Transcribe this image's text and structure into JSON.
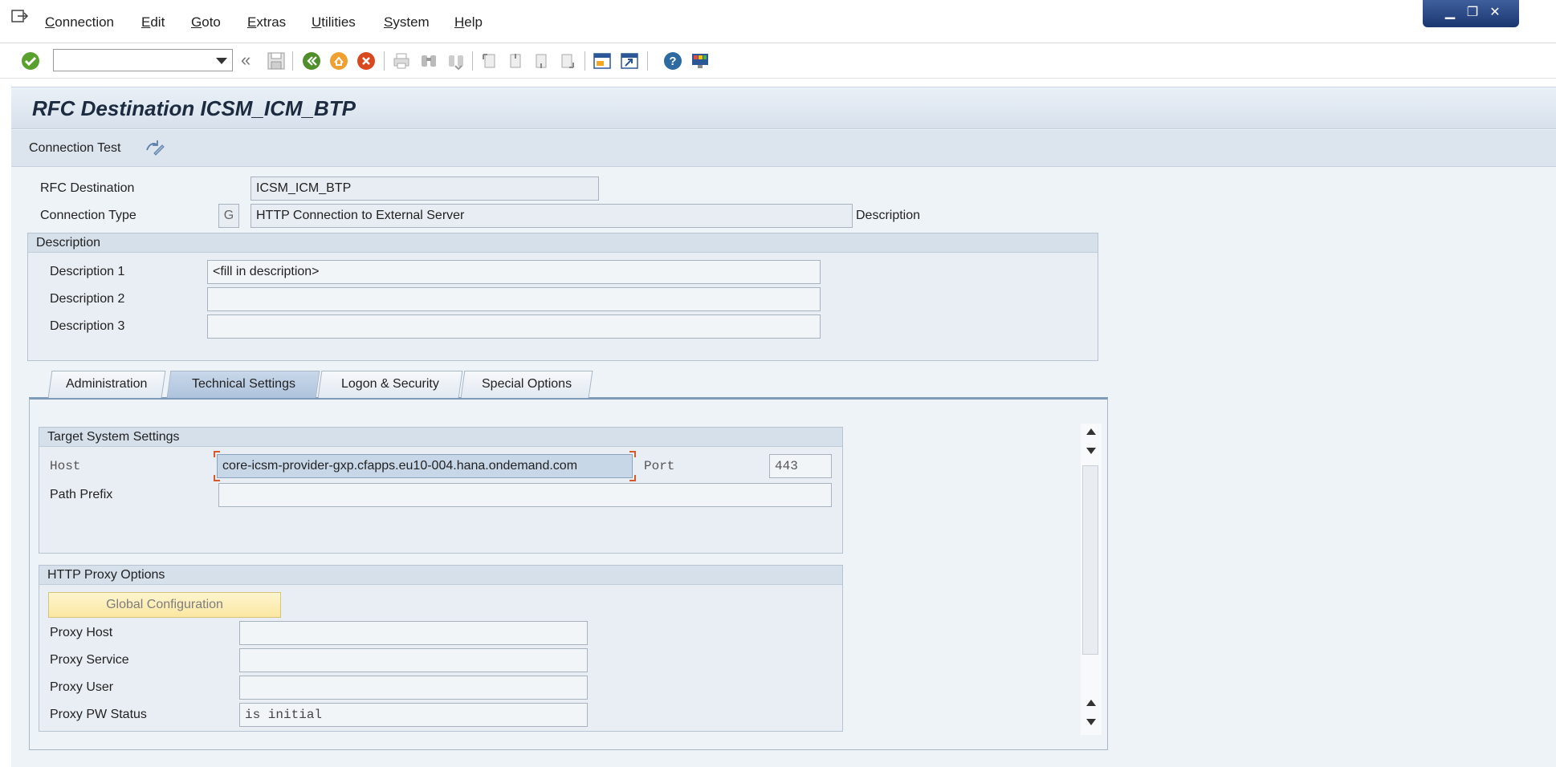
{
  "menubar": {
    "items": [
      "Connection",
      "Edit",
      "Goto",
      "Extras",
      "Utilities",
      "System",
      "Help"
    ]
  },
  "window_controls": {
    "minimize": "▁",
    "restore": "❐",
    "close": "✕"
  },
  "toolbar": {
    "command_field_value": "",
    "icons": [
      "enter-icon",
      "back-icon",
      "exit-icon",
      "cancel-icon",
      "save-icon",
      "print-icon",
      "find-icon",
      "find-next-icon",
      "first-page-icon",
      "previous-page-icon",
      "next-page-icon",
      "last-page-icon",
      "create-session-icon",
      "shortcut-icon",
      "help-icon",
      "customize-layout-icon"
    ]
  },
  "screen": {
    "title": "RFC Destination ICSM_ICM_BTP",
    "connection_test_label": "Connection Test"
  },
  "header_fields": {
    "rfc_destination_label": "RFC Destination",
    "rfc_destination_value": "ICSM_ICM_BTP",
    "connection_type_label": "Connection Type",
    "connection_type_code": "G",
    "connection_type_value": "HTTP Connection to External Server",
    "description_link": "Description"
  },
  "description_group": {
    "title": "Description",
    "fields": [
      {
        "label": "Description 1",
        "value": "<fill in description>"
      },
      {
        "label": "Description 2",
        "value": ""
      },
      {
        "label": "Description 3",
        "value": ""
      }
    ]
  },
  "tabs": [
    {
      "label": "Administration",
      "active": false
    },
    {
      "label": "Technical Settings",
      "active": true
    },
    {
      "label": "Logon & Security",
      "active": false
    },
    {
      "label": "Special Options",
      "active": false
    }
  ],
  "target_system": {
    "title": "Target System Settings",
    "host_label": "Host",
    "host_value": "core-icsm-provider-gxp.cfapps.eu10-004.hana.ondemand.com",
    "port_label": "Port",
    "port_value": "443",
    "path_prefix_label": "Path Prefix",
    "path_prefix_value": ""
  },
  "proxy": {
    "title": "HTTP Proxy Options",
    "global_config_button": "Global Configuration",
    "fields": [
      {
        "label": "Proxy Host",
        "value": ""
      },
      {
        "label": "Proxy Service",
        "value": ""
      },
      {
        "label": "Proxy User",
        "value": ""
      },
      {
        "label": "Proxy PW Status",
        "value": "is initial"
      }
    ]
  },
  "colors": {
    "title_text": "#1c2b3f",
    "page_bg": "#eef3f8",
    "active_tab": "#aec3dc",
    "global_button_bg": "#fbe7a2",
    "focus_corner": "#d85a2a"
  }
}
